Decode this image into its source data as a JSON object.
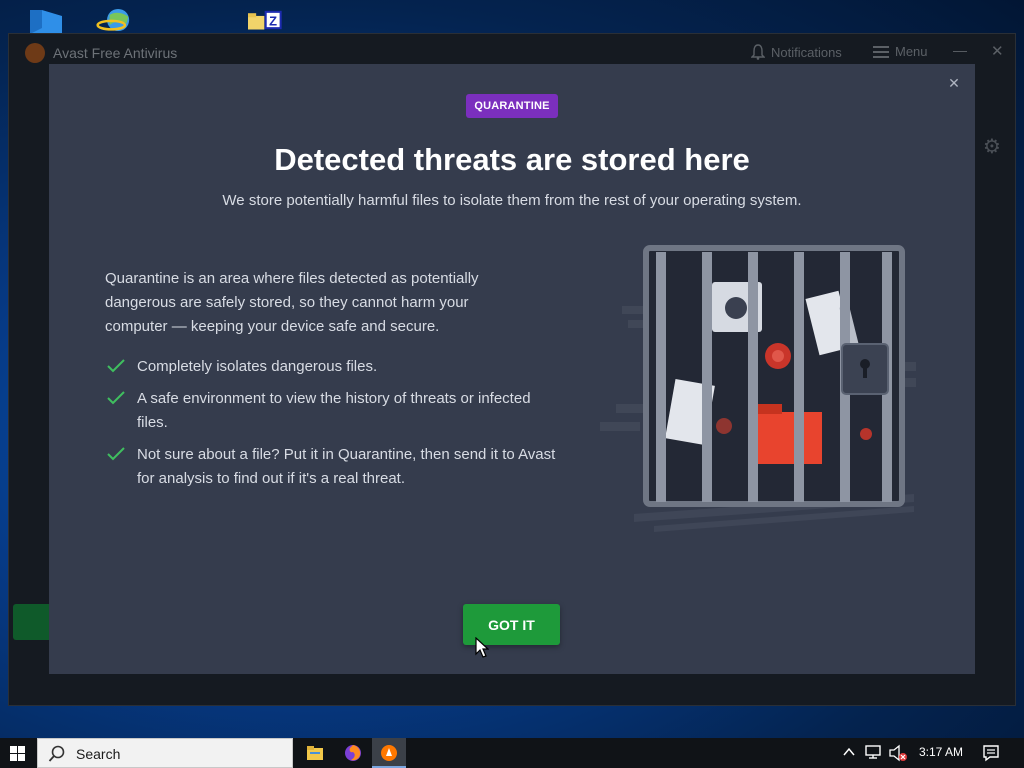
{
  "app": {
    "title": "Avast Free Antivirus",
    "notifications_label": "Notifications",
    "menu_label": "Menu",
    "minimize_glyph": "—",
    "close_glyph": "✕",
    "gear_glyph": "⚙"
  },
  "modal": {
    "badge": "QUARANTINE",
    "headline": "Detected threats are stored here",
    "subline": "We store potentially harmful files to isolate them from the rest of your operating system.",
    "description": "Quarantine is an area where files detected as potentially dangerous are safely stored, so they cannot harm your computer — keeping your device safe and secure.",
    "features": [
      "Completely isolates dangerous files.",
      "A safe environment to view the history of threats or infected files.",
      "Not sure about a file? Put it in Quarantine, then send it to Avast for analysis to find out if it's a real threat."
    ],
    "close_glyph": "✕",
    "button_label": "GOT IT"
  },
  "taskbar": {
    "search_placeholder": "Search",
    "time": "3:17 AM",
    "apps": [
      "file-explorer",
      "firefox",
      "avast"
    ]
  },
  "colors": {
    "modal_bg": "#353c4d",
    "badge": "#7b2fbe",
    "accent_green": "#1e9a3a",
    "check_green": "#3fbf5f"
  }
}
